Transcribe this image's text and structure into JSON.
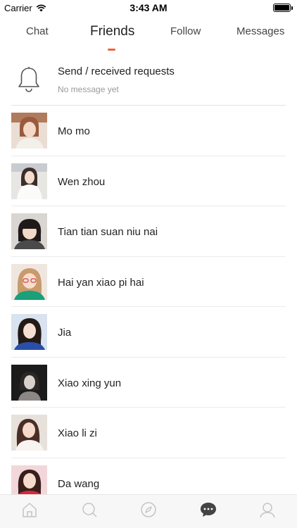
{
  "status_bar": {
    "carrier": "Carrier",
    "time": "3:43 AM"
  },
  "tabs": [
    {
      "label": "Chat"
    },
    {
      "label": "Friends",
      "active": true
    },
    {
      "label": "Follow"
    },
    {
      "label": "Messages"
    }
  ],
  "requests": {
    "title": "Send / received requests",
    "subtitle": "No message yet"
  },
  "friends": [
    {
      "name": "Mo mo"
    },
    {
      "name": "Wen zhou"
    },
    {
      "name": "Tian tian suan niu nai"
    },
    {
      "name": "Hai yan xiao pi hai"
    },
    {
      "name": "Jia"
    },
    {
      "name": "Xiao xing yun"
    },
    {
      "name": "Xiao li zi"
    },
    {
      "name": "Da wang"
    }
  ],
  "bottom_nav": [
    {
      "icon": "home-icon"
    },
    {
      "icon": "search-icon"
    },
    {
      "icon": "compass-icon"
    },
    {
      "icon": "chat-bubble-icon",
      "active": true
    },
    {
      "icon": "profile-icon"
    }
  ],
  "colors": {
    "accent": "#f0633b",
    "active_nav": "#444444",
    "inactive_nav": "#c4c4c4"
  }
}
